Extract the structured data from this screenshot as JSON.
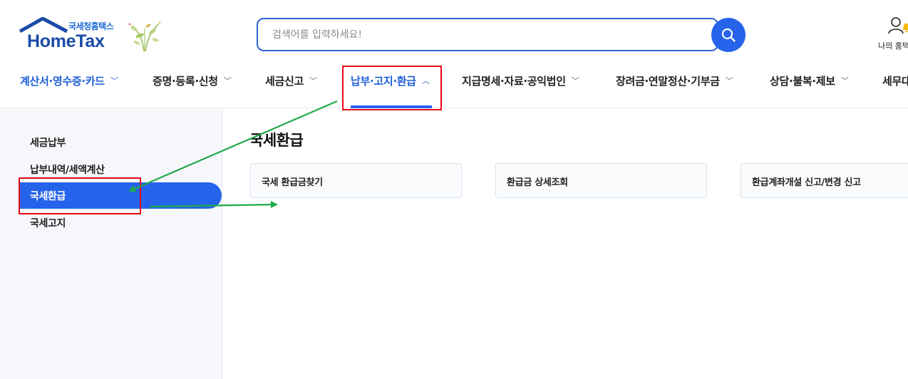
{
  "header": {
    "logo_small": "국세청홈택스",
    "logo_big": "HomeTax",
    "search_placeholder": "검색어를 입력하세요!",
    "mypage_label": "나의 홈택스"
  },
  "nav": {
    "items": [
      {
        "label": "계산서·영수증·카드"
      },
      {
        "label": "증명·등록·신청"
      },
      {
        "label": "세금신고"
      },
      {
        "label": "납부·고지·환급"
      },
      {
        "label": "지급명세·자료·공익법인"
      },
      {
        "label": "장려금·연말정산·기부금"
      },
      {
        "label": "상담·불복·제보"
      },
      {
        "label": "세무대리"
      }
    ],
    "chevron_down": "﹀",
    "chevron_up": "︿"
  },
  "sidebar": {
    "items": [
      {
        "label": "세금납부"
      },
      {
        "label": "납부내역/세액계산"
      },
      {
        "label": "국세환급"
      },
      {
        "label": "국세고지"
      }
    ]
  },
  "main": {
    "title": "국세환급",
    "cards": [
      {
        "label": "국세 환급금찾기"
      },
      {
        "label": "환급금 상세조회"
      },
      {
        "label": "환급계좌개설 신고/변경 신고"
      }
    ]
  },
  "colors": {
    "accent": "#2563eb",
    "highlight_box": "#e50914",
    "annotation_arrow": "#1fa84a"
  }
}
